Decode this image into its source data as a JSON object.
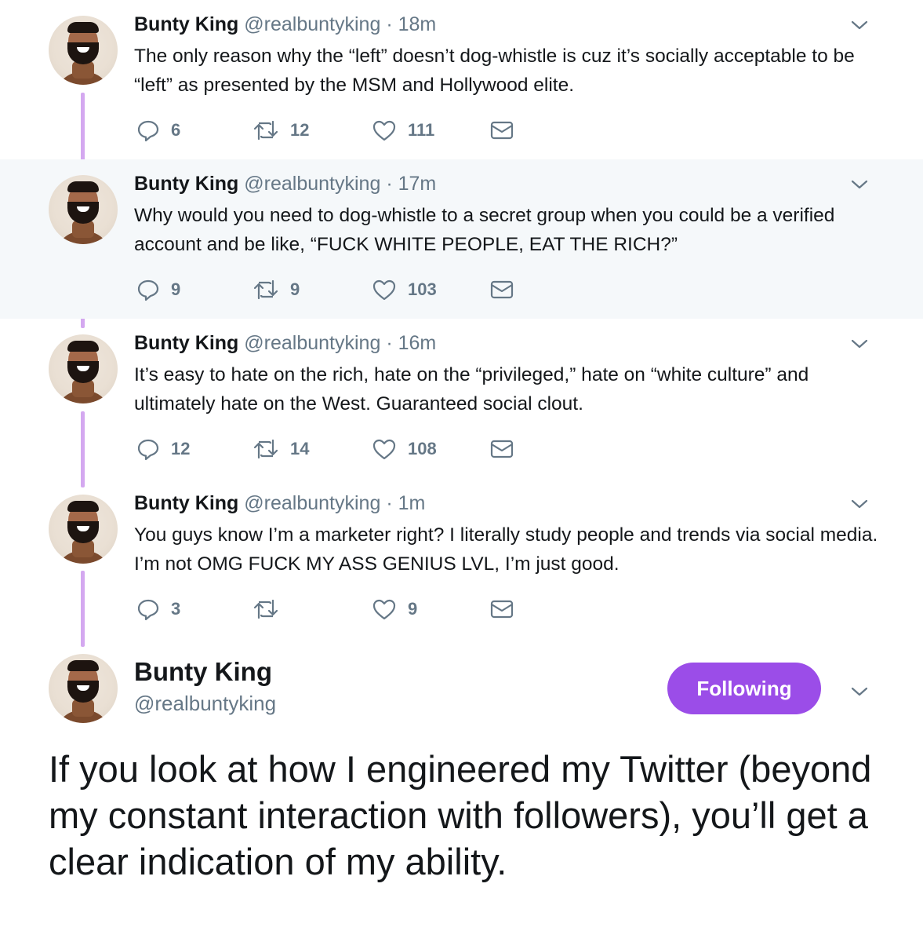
{
  "tweets": [
    {
      "name": "Bunty King",
      "handle": "@realbuntyking",
      "dot": "·",
      "time": "18m",
      "text": "The only reason why the “left” doesn’t dog-whistle is cuz it’s socially acceptable to be “left” as presented by the MSM and Hollywood elite.",
      "replies": "6",
      "retweets": "12",
      "likes": "111",
      "highlighted": false
    },
    {
      "name": "Bunty King",
      "handle": "@realbuntyking",
      "dot": "·",
      "time": "17m",
      "text": "Why would you need to dog-whistle to a secret group when you could be a verified account and be like, “FUCK WHITE PEOPLE, EAT THE RICH?”",
      "replies": "9",
      "retweets": "9",
      "likes": "103",
      "highlighted": true
    },
    {
      "name": "Bunty King",
      "handle": "@realbuntyking",
      "dot": "·",
      "time": "16m",
      "text": "It’s easy to hate on the rich, hate on the “privileged,” hate on “white culture” and ultimately hate on the West. Guaranteed social clout.",
      "replies": "12",
      "retweets": "14",
      "likes": "108",
      "highlighted": false
    },
    {
      "name": "Bunty King",
      "handle": "@realbuntyking",
      "dot": "·",
      "time": "1m",
      "text": "You guys know I’m a marketer right? I literally study people and trends via social media. I’m not OMG FUCK MY ASS GENIUS LVL, I’m just good.",
      "replies": "3",
      "retweets": "",
      "likes": "9",
      "highlighted": false
    }
  ],
  "profile": {
    "name": "Bunty King",
    "handle": "@realbuntyking",
    "follow_label": "Following"
  },
  "main_tweet": {
    "text": "If you look at how I engineered my Twitter (beyond my constant interaction with followers), you’ll get a clear indication of my ability."
  },
  "colors": {
    "accent": "#9b4de8",
    "thread_line": "#d4a8f0",
    "muted": "#657786",
    "highlight_bg": "#f5f8fa"
  },
  "icons": [
    "reply-icon",
    "retweet-icon",
    "like-icon",
    "direct-message-icon",
    "chevron-down-icon"
  ]
}
